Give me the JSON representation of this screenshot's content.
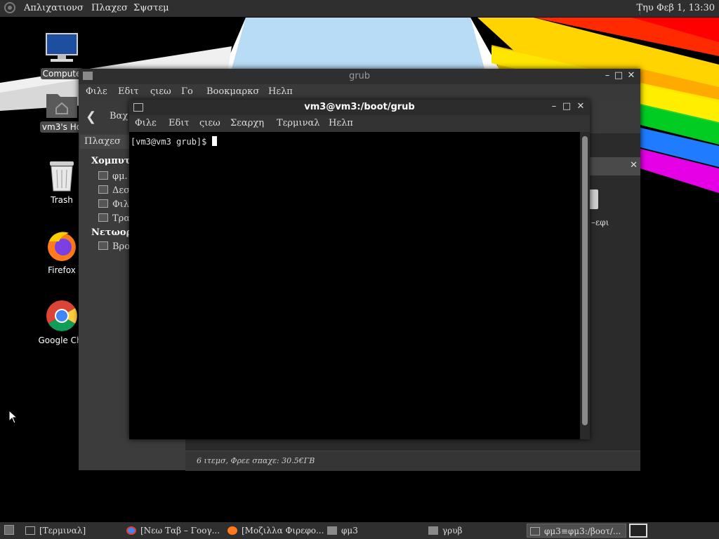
{
  "top_panel": {
    "menu": [
      "Απλιχατιονσ",
      "Πλαχεσ",
      "Σψστεμ"
    ],
    "clock": "Τηυ Φεβ  1, 13:30"
  },
  "desktop": {
    "icons": [
      {
        "label": "Compute",
        "icon": "computer-icon"
      },
      {
        "label": "vm3's Ho",
        "icon": "home-folder-icon"
      },
      {
        "label": "Trash",
        "icon": "trash-icon"
      },
      {
        "label": "Firefox",
        "icon": "firefox-icon"
      },
      {
        "label": "Google Chr",
        "icon": "chrome-icon"
      }
    ]
  },
  "file_manager": {
    "title": "grub",
    "menu": [
      "Φιλε",
      "Εδιτ",
      "ςιεω",
      "Γο",
      "Βοοκμαρκσ",
      "Ηελπ"
    ],
    "back_label": "Βαχ",
    "places_label": "Πλαχεσ",
    "sections": [
      {
        "header": "Χομπυτε",
        "items": [
          "φμ.",
          "Δεσ",
          "Φιλ",
          "Τρα"
        ]
      },
      {
        "header": "Νετωορκ",
        "items": [
          "Βρο"
        ]
      }
    ],
    "file_label": "–εφι",
    "status": "6 ιτεμσ, Φρεε σπαχε: 30.5€ΓΒ"
  },
  "terminal": {
    "title": "vm3@vm3:/boot/grub",
    "menu": [
      "Φιλε",
      "Εδιτ",
      "ςιεω",
      "Σεαρχη",
      "Τερμιναλ",
      "Ηελπ"
    ],
    "prompt": "[vm3@vm3 grub]$ "
  },
  "taskbar": {
    "tasks": [
      {
        "label": "[Τερμιναλ]",
        "icon": "terminal-icon",
        "active": false
      },
      {
        "label": "[Νεω Ταβ – Γοογ...",
        "icon": "chrome-icon",
        "active": false
      },
      {
        "label": "[Μοζιλλα Φιρεφο...",
        "icon": "firefox-icon",
        "active": false
      },
      {
        "label": "φμ3",
        "icon": "folder-icon",
        "active": false
      },
      {
        "label": "γρυβ",
        "icon": "folder-icon",
        "active": false
      },
      {
        "label": "φμ3≡φμ3:/βοοτ/...",
        "icon": "terminal-icon",
        "active": true
      }
    ]
  },
  "colors": {
    "panel": "#2f2f2f",
    "window_bg": "#353535",
    "terminal_bg": "#000000"
  }
}
